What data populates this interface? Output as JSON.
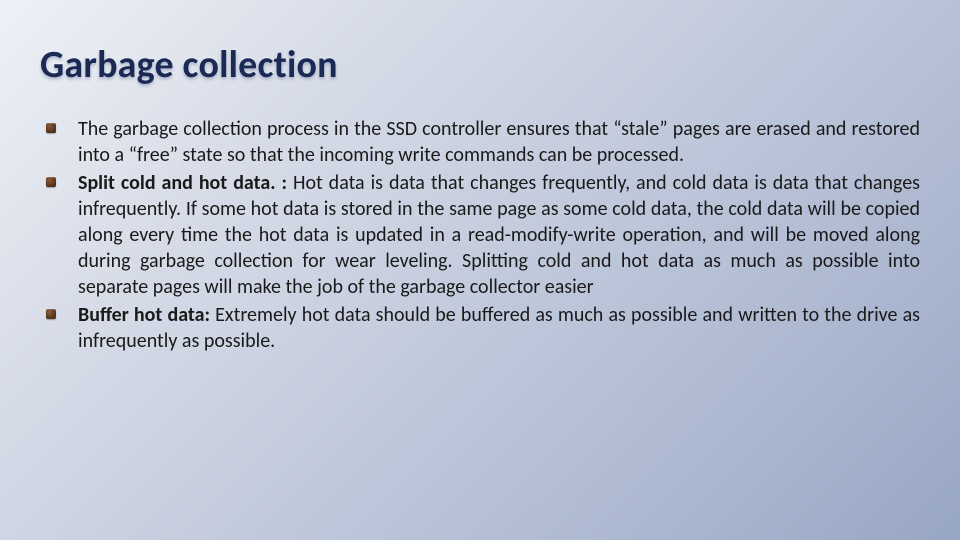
{
  "title": "Garbage collection",
  "bullets": [
    {
      "lead": "",
      "text": "The garbage collection process in the SSD controller ensures that “stale” pages are erased and restored into a “free” state so that the incoming write commands can be processed."
    },
    {
      "lead": "Split cold and hot data. :",
      "text": " Hot data is data that changes frequently, and cold data is data that changes infrequently. If some hot data is stored in the same page as some cold data, the cold data will be copied along every time the hot data is updated in a read-modify-write operation, and will be moved along during garbage collection for wear leveling. Splitting cold and hot data as much as possible into separate pages will make the job of the garbage collector easier"
    },
    {
      "lead": "Buffer hot data:",
      "text": " Extremely hot data should be buffered as much as possible and written to the drive as infrequently as possible."
    }
  ]
}
